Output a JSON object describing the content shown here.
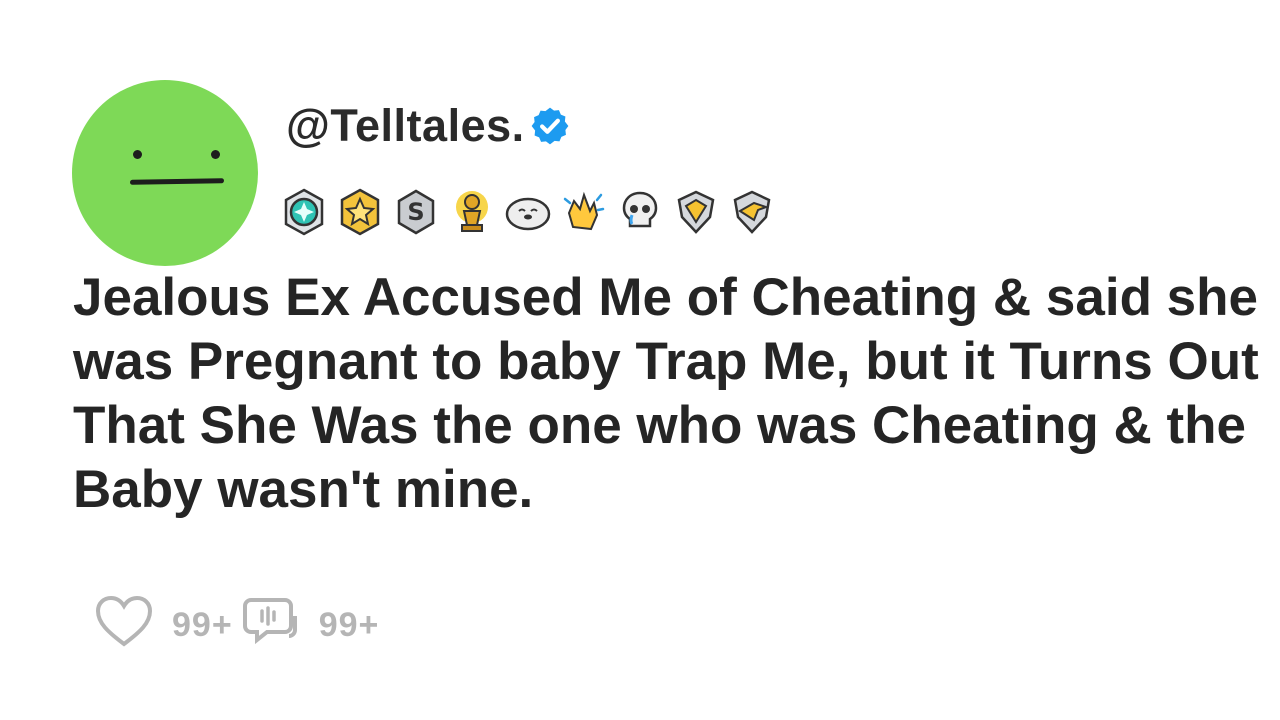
{
  "post": {
    "username": "@Telltales.",
    "verified_icon": "verified-check-icon",
    "avatar_icon": "neutral-face-avatar",
    "badges": [
      "teal-gem-medal-icon",
      "gold-star-medal-icon",
      "silver-s-medal-icon",
      "gold-trophy-figure-icon",
      "seal-icon",
      "clapping-hands-icon",
      "crying-skull-icon",
      "gold-diamond-shield-icon",
      "gold-bird-shield-icon"
    ],
    "title": "Jealous Ex Accused Me of Cheating & said she was Pregnant to baby Trap Me, but it Turns Out That She Was the one who was Cheating & the Baby wasn't mine."
  },
  "actions": {
    "like_icon": "heart-icon",
    "like_count": "99+",
    "comment_icon": "comment-icon",
    "comment_count": "99+"
  },
  "colors": {
    "avatar": "#7ed957",
    "verified": "#1d9bf0",
    "text": "#2b2b2b",
    "muted": "#b5b5b5"
  }
}
